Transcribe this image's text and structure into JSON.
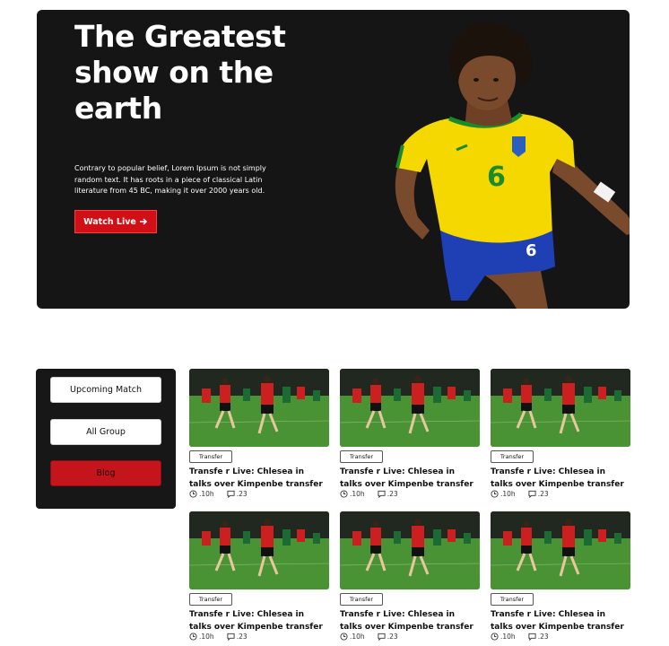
{
  "hero": {
    "title": "The Greatest show on the earth",
    "description": "Contrary to popular belief, Lorem Ipsum is not simply random text. It has roots in a piece of classical Latin literature from 45 BC, making it over 2000 years old.",
    "watch_label": "Watch Live",
    "player_jersey_number": "6",
    "player_shorts_number": "6"
  },
  "sidebar": {
    "buttons": [
      "Upcoming Match",
      "All Group",
      "Blog"
    ]
  },
  "cards": [
    {
      "tag": "Transfer",
      "title": "Transfe r Live: Chlesea in talks over Kimpenbe transfer",
      "time": ".10h",
      "comments": ".23"
    },
    {
      "tag": "Transfer",
      "title": "Transfe r Live: Chlesea in talks over Kimpenbe transfer",
      "time": ".10h",
      "comments": ".23"
    },
    {
      "tag": "Transfer",
      "title": "Transfe r Live: Chlesea in talks over Kimpenbe transfer",
      "time": ".10h",
      "comments": ".23"
    },
    {
      "tag": "Transfer",
      "title": "Transfe r Live: Chlesea in talks over Kimpenbe transfer",
      "time": ".10h",
      "comments": ".23"
    },
    {
      "tag": "Transfer",
      "title": "Transfe r Live: Chlesea in talks over Kimpenbe transfer",
      "time": ".10h",
      "comments": ".23"
    },
    {
      "tag": "Transfer",
      "title": "Transfe r Live: Chlesea in talks over Kimpenbe transfer",
      "time": ".10h",
      "comments": ".23"
    }
  ],
  "colors": {
    "accent": "#d10f16",
    "hero_bg": "#151515",
    "panel_bg": "#171717",
    "jersey_yellow": "#f5d800",
    "shorts_blue": "#1f3fb5",
    "pitch_green": "#3f8a2e",
    "kit_red": "#cc1f1f"
  },
  "icons": {
    "watch_arrow": "arrow-right-icon",
    "time": "clock-icon",
    "comments": "comment-icon"
  }
}
